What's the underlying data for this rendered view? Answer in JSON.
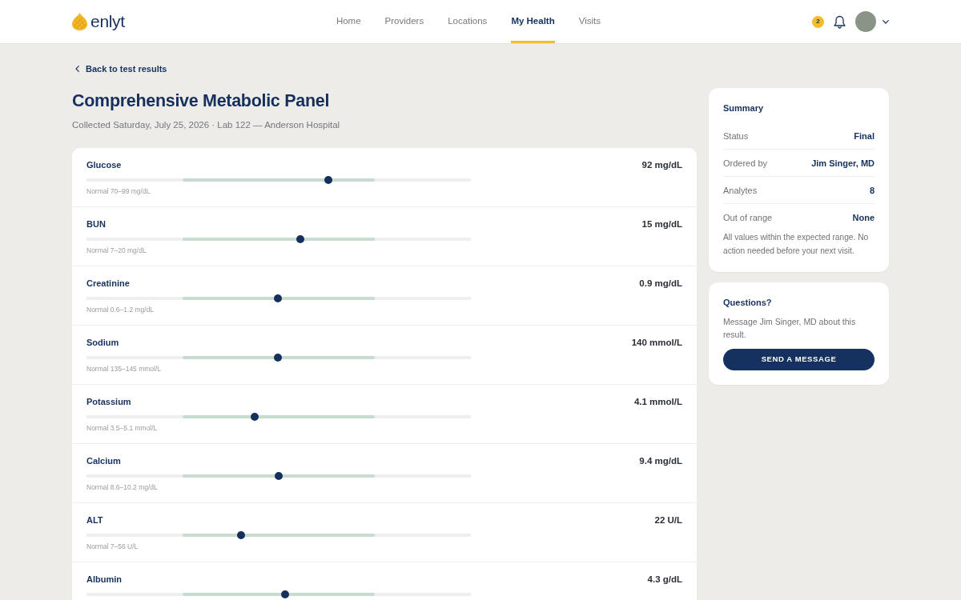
{
  "header": {
    "brand": "enlyt",
    "nav": [
      {
        "label": "Home",
        "selected": false
      },
      {
        "label": "Providers",
        "selected": false
      },
      {
        "label": "Locations",
        "selected": false
      },
      {
        "label": "My Health",
        "selected": true
      },
      {
        "label": "Visits",
        "selected": false
      }
    ],
    "notification_count": "2"
  },
  "back_link": "Back to test results",
  "page": {
    "title": "Comprehensive Metabolic Panel",
    "subtitle": "Collected Saturday, July 25, 2026 · Lab 122 — Anderson Hospital"
  },
  "results": [
    {
      "name": "Glucose",
      "value": "92 mg/dL",
      "level": 0.629,
      "range": "Normal 70–99 mg/dL"
    },
    {
      "name": "BUN",
      "value": "15 mg/dL",
      "level": 0.556,
      "range": "Normal 7–20 mg/dL"
    },
    {
      "name": "Creatinine",
      "value": "0.9 mg/dL",
      "level": 0.498,
      "range": "Normal 0.6–1.2 mg/dL"
    },
    {
      "name": "Sodium",
      "value": "140 mmol/L",
      "level": 0.498,
      "range": "Normal 135–145 mmol/L"
    },
    {
      "name": "Potassium",
      "value": "4.1 mmol/L",
      "level": 0.438,
      "range": "Normal 3.5–5.1 mmol/L"
    },
    {
      "name": "Calcium",
      "value": "9.4 mg/dL",
      "level": 0.5,
      "range": "Normal 8.6–10.2 mg/dL"
    },
    {
      "name": "ALT",
      "value": "22 U/L",
      "level": 0.402,
      "range": "Normal 7–56 U/L"
    },
    {
      "name": "Albumin",
      "value": "4.3 g/dL",
      "level": 0.517
    }
  ],
  "summary": {
    "title": "Summary",
    "rows": [
      {
        "label": "Status",
        "value": "Final"
      },
      {
        "label": "Ordered by",
        "value": "Jim Singer, MD"
      },
      {
        "label": "Analytes",
        "value": "8"
      },
      {
        "label": "Out of range",
        "value": "None"
      }
    ],
    "note": "All values within the expected range. No action needed before your next visit."
  },
  "questions": {
    "title": "Questions?",
    "text": "Message Jim Singer, MD about this result.",
    "button": "SEND A MESSAGE"
  }
}
